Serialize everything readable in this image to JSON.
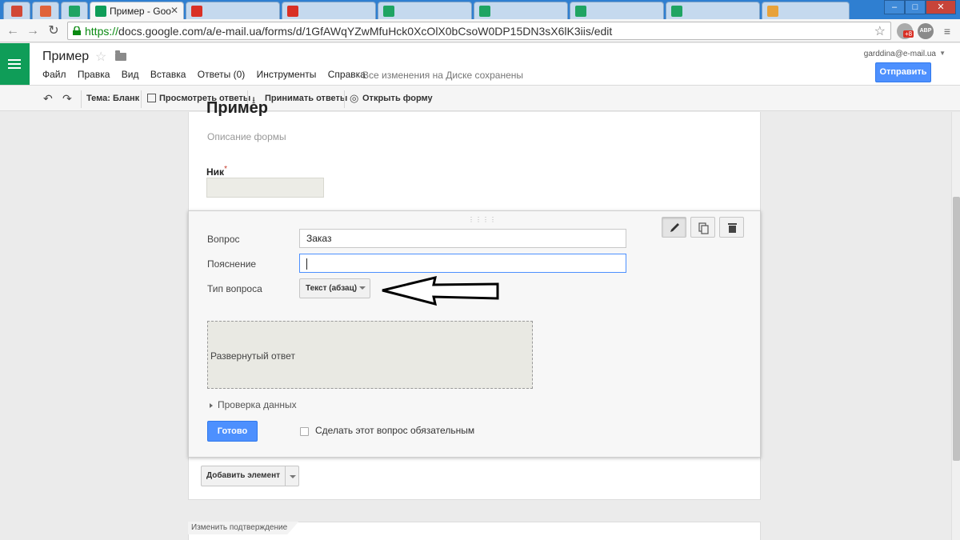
{
  "browser": {
    "tabs": [
      {
        "title": "",
        "icon": "gmail-icon",
        "color": "#d14836"
      },
      {
        "title": "",
        "icon": "calendar-icon",
        "color": "#e0633a"
      },
      {
        "title": "",
        "icon": "drive-icon",
        "color": "#1fa463"
      },
      {
        "title": "Пример - Goo",
        "icon": "forms-icon",
        "color": "#0f9d58",
        "active": true
      },
      {
        "title": "",
        "icon": "web-icon",
        "color": "#d93025"
      },
      {
        "title": "",
        "icon": "web-icon",
        "color": "#d93025"
      },
      {
        "title": "",
        "icon": "sheets-icon",
        "color": "#1fa463"
      },
      {
        "title": "",
        "icon": "sheets-icon",
        "color": "#1fa463"
      },
      {
        "title": "",
        "icon": "sheets-icon",
        "color": "#1fa463"
      },
      {
        "title": "",
        "icon": "sheets-icon",
        "color": "#1fa463"
      },
      {
        "title": "",
        "icon": "web-icon",
        "color": "#e8a23a"
      }
    ],
    "url_protocol": "https://",
    "url_rest": "docs.google.com/a/e-mail.ua/forms/d/1GfAWqYZwMfuHck0XcOlX0bCsoW0DP15DN3sX6lK3iis/edit",
    "extension_badge": "+8",
    "abp_label": "ABP"
  },
  "header": {
    "title": "Пример",
    "menu": [
      "Файл",
      "Правка",
      "Вид",
      "Вставка",
      "Ответы (0)",
      "Инструменты",
      "Справка"
    ],
    "save_status": "Все изменения на Диске сохранены",
    "user_email": "garddina@e-mail.ua",
    "send_label": "Отправить"
  },
  "toolbar": {
    "theme": "Тема: Бланк",
    "view_responses": "Просмотреть ответы",
    "accept_responses": "Принимать ответы",
    "open_form": "Открыть форму"
  },
  "form": {
    "title": "Пример",
    "description": "Описание формы",
    "question1_label": "Ник",
    "question1_required_mark": "*"
  },
  "editor": {
    "question_label": "Вопрос",
    "question_value": "Заказ",
    "hint_label": "Пояснение",
    "hint_value": "",
    "type_label": "Тип вопроса",
    "type_value": "Текст (абзац)",
    "preview_text": "Развернутый ответ",
    "validation_label": "Проверка данных",
    "done_label": "Готово",
    "required_label": "Сделать этот вопрос обязательным"
  },
  "add_item_label": "Добавить элемент",
  "confirmation_tab": "Изменить подтверждение",
  "colors": {
    "accent_blue": "#4d90fe",
    "forms_green": "#0f9d58"
  }
}
